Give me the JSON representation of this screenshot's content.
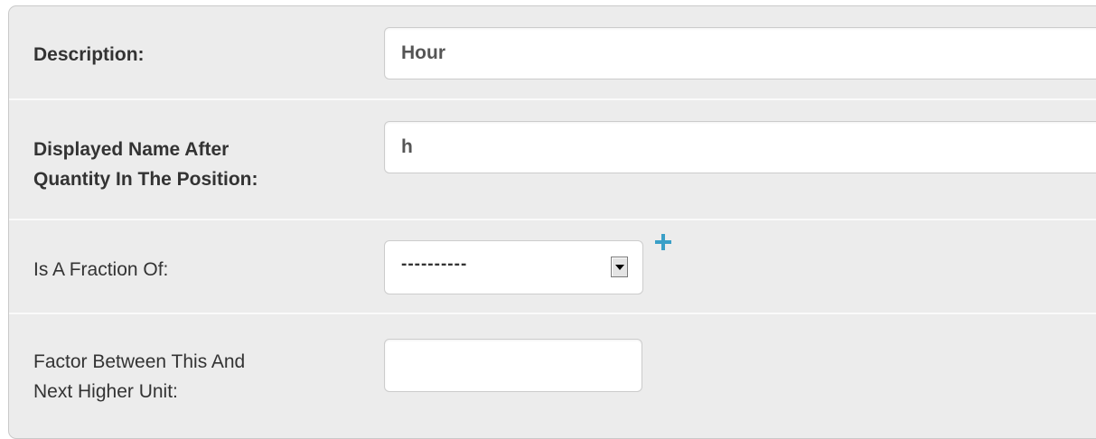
{
  "form": {
    "description": {
      "label": "Description:",
      "value": "Hour"
    },
    "displayed_name": {
      "label_line1": "Displayed Name After",
      "label_line2": "Quantity In The Position:",
      "value": "h"
    },
    "fraction_of": {
      "label": "Is A Fraction Of:",
      "selected": "----------",
      "add_icon": "plus-icon"
    },
    "factor": {
      "label_line1": "Factor Between This And",
      "label_line2": "Next Higher Unit:",
      "value": ""
    }
  },
  "colors": {
    "panel_background": "#ececec",
    "add_icon": "#3a9fc7"
  }
}
